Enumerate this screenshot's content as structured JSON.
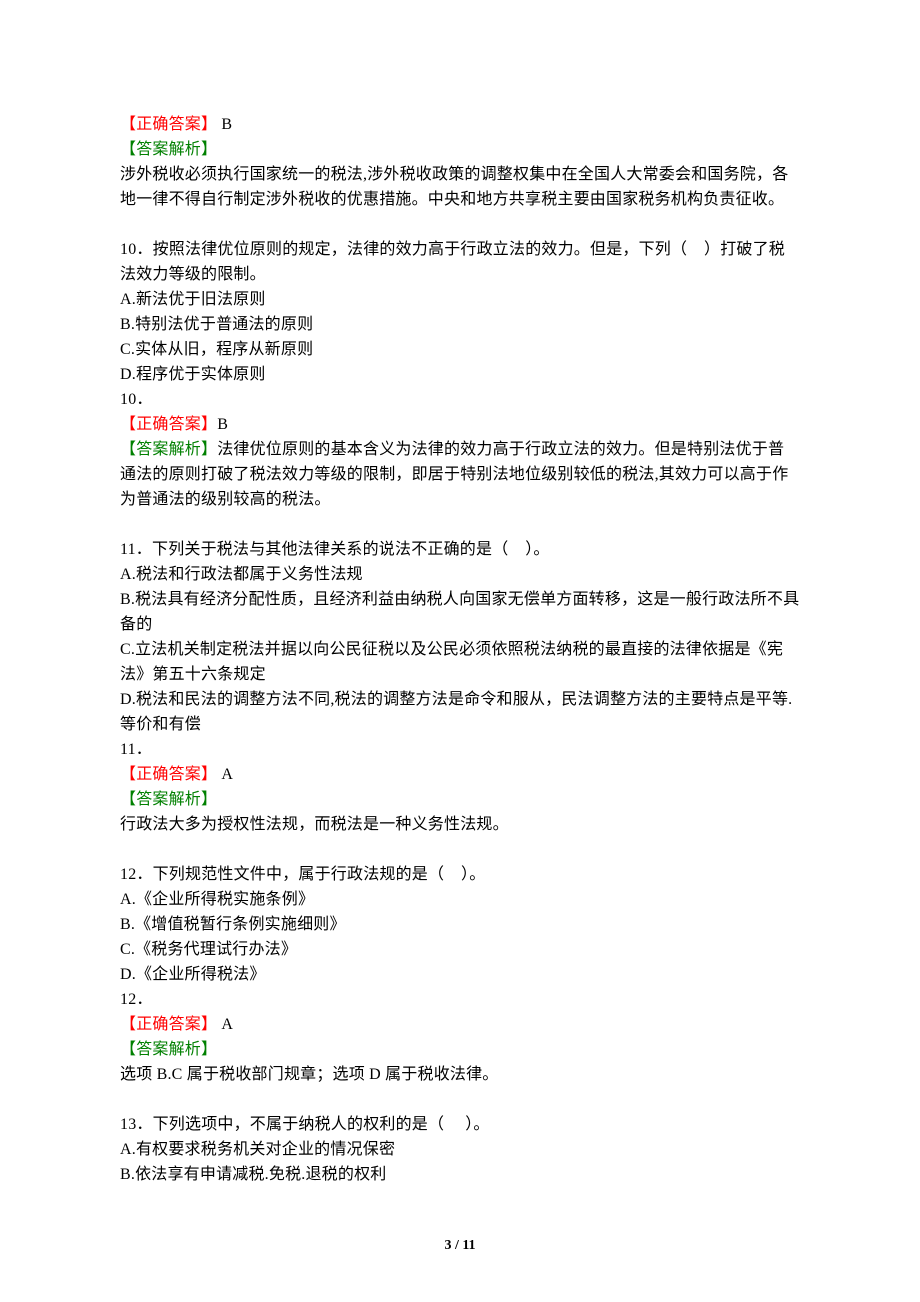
{
  "q9": {
    "ans_label": "【正确答案】",
    "ans": " B",
    "exp_label": "【答案解析】",
    "exp1": "涉外税收必须执行国家统一的税法,涉外税收政策的调整权集中在全国人大常委会和国务院，各地一律不得自行制定涉外税收的优惠措施。中央和地方共享税主要由国家税务机构负责征收。"
  },
  "q10": {
    "stem": "10．按照法律优位原则的规定，法律的效力高于行政立法的效力。但是，下列（    ）打破了税法效力等级的限制。",
    "A": "A.新法优于旧法原则",
    "B": "B.特别法优于普通法的原则",
    "C": "C.实体从旧，程序从新原则",
    "D": "D.程序优于实体原则",
    "num": "10．",
    "ans_label": "【正确答案】",
    "ans": "B",
    "exp_label": "【答案解析】",
    "exp": "法律优位原则的基本含义为法律的效力高于行政立法的效力。但是特别法优于普通法的原则打破了税法效力等级的限制，即居于特别法地位级别较低的税法,其效力可以高于作为普通法的级别较高的税法。"
  },
  "q11": {
    "stem": "11．下列关于税法与其他法律关系的说法不正确的是（    ）。",
    "A": "A.税法和行政法都属于义务性法规",
    "B": "B.税法具有经济分配性质，且经济利益由纳税人向国家无偿单方面转移，这是一般行政法所不具备的",
    "C": "C.立法机关制定税法并据以向公民征税以及公民必须依照税法纳税的最直接的法律依据是《宪法》第五十六条规定",
    "D": "D.税法和民法的调整方法不同,税法的调整方法是命令和服从，民法调整方法的主要特点是平等.等价和有偿",
    "num": "11．",
    "ans_label": "【正确答案】",
    "ans": " A",
    "exp_label": "【答案解析】",
    "exp": "行政法大多为授权性法规，而税法是一种义务性法规。"
  },
  "q12": {
    "stem": "12．下列规范性文件中，属于行政法规的是（    ）。",
    "A": "A.《企业所得税实施条例》",
    "B": "B.《增值税暂行条例实施细则》",
    "C": "C.《税务代理试行办法》",
    "D": "D.《企业所得税法》",
    "num": "12．",
    "ans_label": "【正确答案】",
    "ans": " A",
    "exp_label": "【答案解析】",
    "exp": "选项 B.C 属于税收部门规章；选项 D 属于税收法律。"
  },
  "q13": {
    "stem": "13．下列选项中，不属于纳税人的权利的是（     ）。",
    "A": "A.有权要求税务机关对企业的情况保密",
    "B": "B.依法享有申请减税.免税.退税的权利"
  },
  "footer": "3 / 11"
}
